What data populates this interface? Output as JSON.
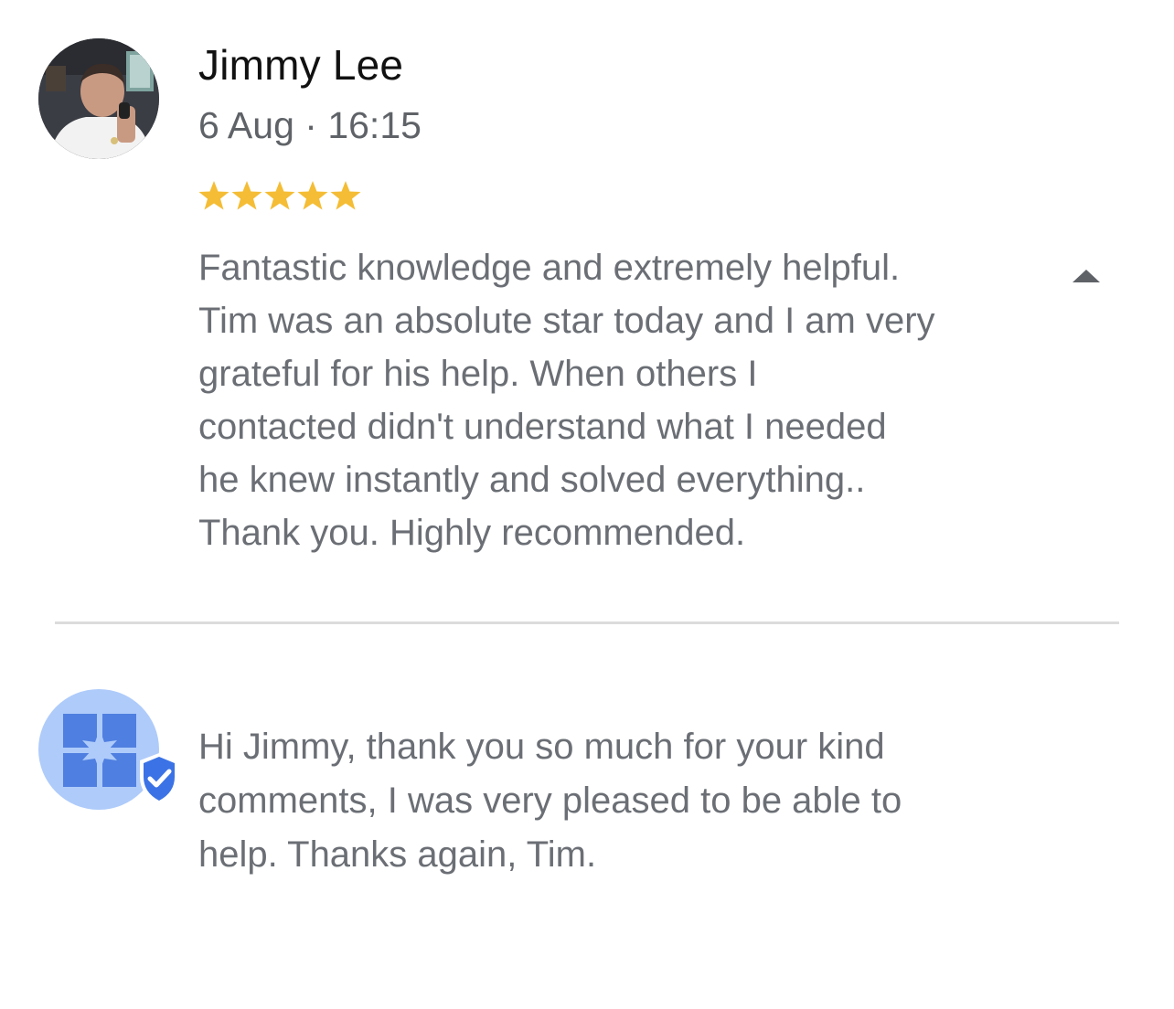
{
  "review": {
    "author_name": "Jimmy Lee",
    "meta": "6 Aug · 16:15",
    "rating": 5,
    "rating_max": 5,
    "text": "Fantastic knowledge and extremely helpful.\nTim was an absolute star today and I am very\ngrateful for his help.  When others I\ncontacted didn't understand what I needed\nhe knew instantly and solved everything..\nThank you.  Highly recommended.",
    "collapse_icon": "chevron-up-icon"
  },
  "owner_response": {
    "icon": "business-verified-icon",
    "text": "Hi Jimmy, thank you so much for your kind\ncomments, I was very pleased to be able to\nhelp. Thanks again, Tim."
  },
  "colors": {
    "star": "#f4bd35",
    "text_secondary": "#6b6f75",
    "owner_avatar_bg": "#aecbfa",
    "owner_logo": "#4f7fe0",
    "verified_shield": "#3b73e6",
    "divider": "#dcdcdc"
  }
}
